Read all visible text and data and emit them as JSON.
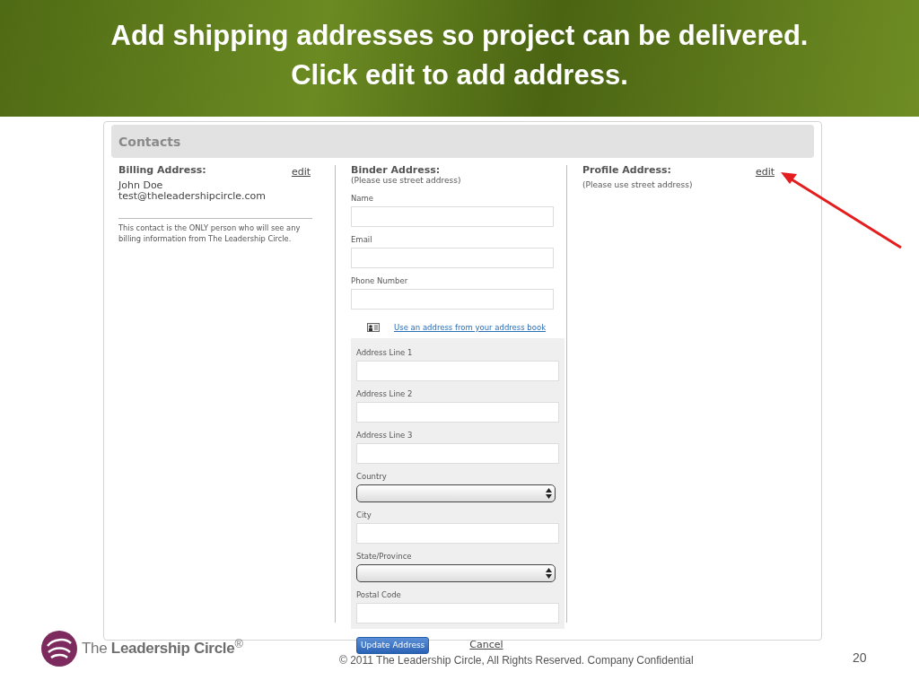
{
  "slide": {
    "title_lines": [
      "Add shipping addresses so project can be delivered.",
      "Click edit to add address."
    ]
  },
  "contacts": {
    "title": "Contacts",
    "billing": {
      "heading": "Billing Address:",
      "edit": "edit",
      "lines": [
        "John Doe",
        "test@theleadershipcircle.com"
      ],
      "note": "This contact is the ONLY person who will see any billing information from The Leadership Circle."
    },
    "binder": {
      "heading": "Binder Address:",
      "hint": "(Please use street address)",
      "contact_fields": [
        {
          "label": "Name",
          "kind": "text"
        },
        {
          "label": "Email",
          "kind": "text"
        },
        {
          "label": "Phone Number",
          "kind": "text"
        }
      ],
      "address_book_link": "Use an address from your address book",
      "address_fields": [
        {
          "label": "Address Line 1",
          "kind": "text"
        },
        {
          "label": "Address Line 2",
          "kind": "text"
        },
        {
          "label": "Address Line 3",
          "kind": "text"
        },
        {
          "label": "Country",
          "kind": "select"
        },
        {
          "label": "City",
          "kind": "text"
        },
        {
          "label": "State/Province",
          "kind": "select"
        },
        {
          "label": "Postal Code",
          "kind": "text"
        }
      ],
      "submit": "Update Address",
      "cancel": "Cancel"
    },
    "profile": {
      "heading": "Profile Address:",
      "hint": "(Please use street address)",
      "edit": "edit"
    }
  },
  "footer": {
    "logo": "The **Leadership Circle**$^{®}$",
    "copyright": "© 2011 The Leadership Circle, All Rights Reserved. Company Confidential",
    "page_number": "20"
  }
}
